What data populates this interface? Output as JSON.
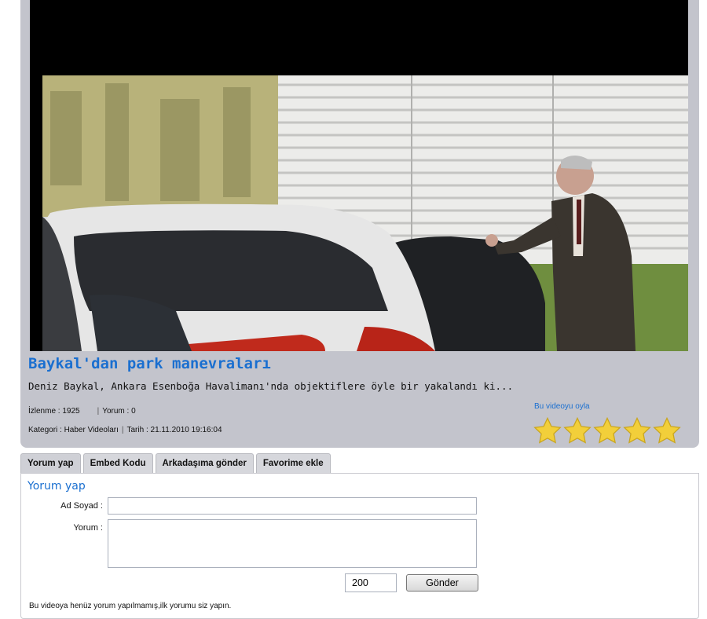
{
  "video": {
    "title": "Baykal'dan park manevraları",
    "description": "Deniz Baykal, Ankara Esenboğa Havalimanı'nda objektiflere öyle bir yakalandı ki...",
    "views_label": "İzlenme : 1925",
    "comments_label": "Yorum : 0",
    "category_label": "Kategori : Haber Videoları",
    "date_label": "Tarih : 21.11.2010 19:16:04",
    "vote_link": "Bu videoyu oyla",
    "rating": {
      "value": 5,
      "max": 5
    },
    "colors": {
      "accent": "#1a6fd0",
      "panel": "#c3c4cc",
      "star": "#f2cf3a"
    }
  },
  "tabs": [
    {
      "label": "Yorum yap"
    },
    {
      "label": "Embed Kodu"
    },
    {
      "label": "Arkadaşıma gönder"
    },
    {
      "label": "Favorime ekle"
    }
  ],
  "comment_form": {
    "title": "Yorum yap",
    "name_label": "Ad Soyad :",
    "name_value": "",
    "comment_label": "Yorum :",
    "comment_value": "",
    "char_counter": "200",
    "submit_label": "Gönder",
    "empty_notice": "Bu videoya henüz yorum yapılmamış,ilk yorumu siz yapın."
  }
}
